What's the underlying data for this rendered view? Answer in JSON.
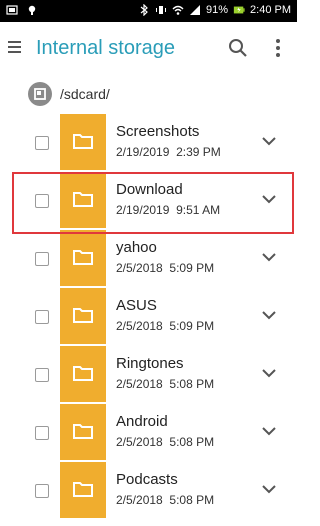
{
  "status_bar": {
    "battery_percent": "91%",
    "time": "2:40 PM"
  },
  "app_bar": {
    "title": "Internal storage",
    "search_icon": "search-icon",
    "more_icon": "more-vert-icon",
    "menu_icon": "menu-icon"
  },
  "path": {
    "text": "/sdcard/"
  },
  "folders": [
    {
      "name": "Screenshots",
      "date": "2/19/2019",
      "time": "2:39 PM"
    },
    {
      "name": "Download",
      "date": "2/19/2019",
      "time": "9:51 AM"
    },
    {
      "name": "yahoo",
      "date": "2/5/2018",
      "time": "5:09 PM"
    },
    {
      "name": "ASUS",
      "date": "2/5/2018",
      "time": "5:09 PM"
    },
    {
      "name": "Ringtones",
      "date": "2/5/2018",
      "time": "5:08 PM"
    },
    {
      "name": "Android",
      "date": "2/5/2018",
      "time": "5:08 PM"
    },
    {
      "name": "Podcasts",
      "date": "2/5/2018",
      "time": "5:08 PM"
    }
  ],
  "colors": {
    "accent": "#2a9db8",
    "folder": "#f0ad2e",
    "highlight": "#e0383c"
  }
}
